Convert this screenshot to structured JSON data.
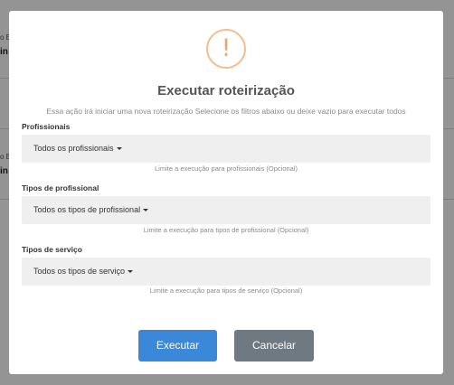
{
  "background": {
    "fragments": [
      "o E",
      "in",
      "o E",
      "in"
    ]
  },
  "dialog": {
    "icon": "exclamation-icon",
    "icon_glyph": "!",
    "title": "Executar roteirização",
    "subtitle": "Essa ação irá iniciar uma nova roteirização Selecione os filtros abaixo ou deixe vazio para executar todos",
    "fields": [
      {
        "label": "Profissionais",
        "value": "Todos os profissionais",
        "help": "Limite a execução para profissionais (Opcional)"
      },
      {
        "label": "Tipos de profissional",
        "value": "Todos os tipos de profissional",
        "help": "Limite a execução para tipos de profissional (Opcional)"
      },
      {
        "label": "Tipos de serviço",
        "value": "Todos os tipos de serviço",
        "help": "Limite a execução para tipos de serviço (Opcional)"
      }
    ],
    "buttons": {
      "execute": "Executar",
      "cancel": "Cancelar"
    }
  },
  "colors": {
    "primary": "#3b87d8",
    "secondary": "#6f7982",
    "warning": "#f0a663",
    "overlay": "rgba(0,0,0,0.42)"
  }
}
